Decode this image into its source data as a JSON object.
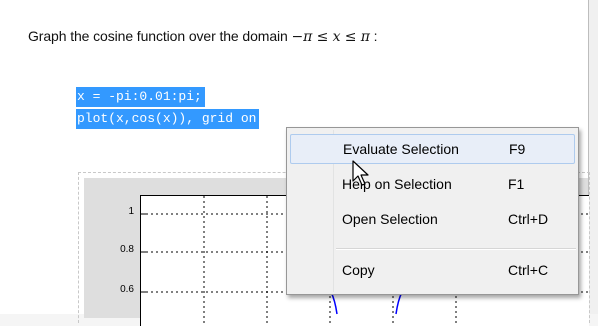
{
  "instruction": {
    "prefix": "Graph the cosine function over the domain",
    "math": "−π ≤ x ≤ π",
    "suffix": ":"
  },
  "code": {
    "line1": "x = -pi:0.01:pi;",
    "line2": "plot(x,cos(x)), grid on"
  },
  "plot": {
    "yticks": [
      "1",
      "0.8",
      "0.6"
    ],
    "line_color": "#0000ff",
    "grid_color": "#000000"
  },
  "context_menu": {
    "items": [
      {
        "label": "Evaluate Selection",
        "shortcut": "F9"
      },
      {
        "label": "Help on Selection",
        "shortcut": "F1"
      },
      {
        "label": "Open Selection",
        "shortcut": "Ctrl+D"
      },
      {
        "label": "Copy",
        "shortcut": "Ctrl+C"
      }
    ],
    "highlighted_index": 0
  },
  "colors": {
    "selection": "#3399ff",
    "menu_background": "#f0f0f0",
    "menu_highlight": "#e8eef8"
  }
}
